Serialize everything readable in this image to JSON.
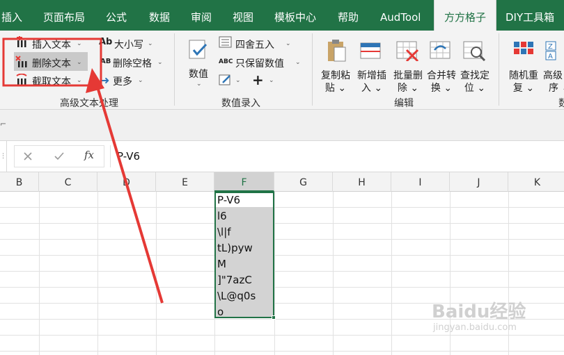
{
  "tabs": [
    {
      "label": "插入",
      "active": false
    },
    {
      "label": "页面布局",
      "active": false
    },
    {
      "label": "公式",
      "active": false
    },
    {
      "label": "数据",
      "active": false
    },
    {
      "label": "审阅",
      "active": false
    },
    {
      "label": "视图",
      "active": false
    },
    {
      "label": "模板中心",
      "active": false
    },
    {
      "label": "帮助",
      "active": false
    },
    {
      "label": "AudTool",
      "active": false
    },
    {
      "label": "方方格子",
      "active": true
    },
    {
      "label": "DIY工具箱",
      "active": false
    }
  ],
  "ribbon": {
    "text_group": {
      "insert_text": "插入文本",
      "delete_text": "删除文本",
      "extract_text": "截取文本",
      "case_change": "大小写",
      "delete_spaces": "删除空格",
      "more": "更多",
      "label": "高级文本处理",
      "ab_glyph": "Ab",
      "abc_glyph": "AB"
    },
    "number_group": {
      "numeric": "数值",
      "round": "四舍五入",
      "keep_numeric": "只保留数值",
      "label": "数值录入",
      "abc_glyph": "ABC"
    },
    "edit_group": {
      "copy_paste_1": "复制粘",
      "copy_paste_2": "贴",
      "add_insert_1": "新增插",
      "add_insert_2": "入",
      "batch_delete_1": "批量删",
      "batch_delete_2": "除",
      "merge_convert_1": "合并转",
      "merge_convert_2": "换",
      "find_locate_1": "查找定",
      "find_locate_2": "位",
      "label": "编辑"
    },
    "random_group": {
      "random_1": "随机重",
      "random_2": "复",
      "sort_1": "高级",
      "sort_2": "序",
      "label_partial": "数"
    }
  },
  "formula_bar": {
    "fx": "fx",
    "value": "P-V6"
  },
  "columns": [
    "B",
    "C",
    "D",
    "E",
    "F",
    "G",
    "H",
    "I",
    "J",
    "K"
  ],
  "selected_column": "F",
  "cells": [
    "P-V6",
    "l6",
    "\\l|f",
    "tL)pyw",
    "M",
    "]\"7azC",
    "\\L@q0s",
    "o"
  ],
  "watermark": {
    "brand": "Baidu经验",
    "url": "jingyan.baidu.com"
  },
  "colors": {
    "ribbon_green": "#217346",
    "annotation_red": "#e53935"
  }
}
